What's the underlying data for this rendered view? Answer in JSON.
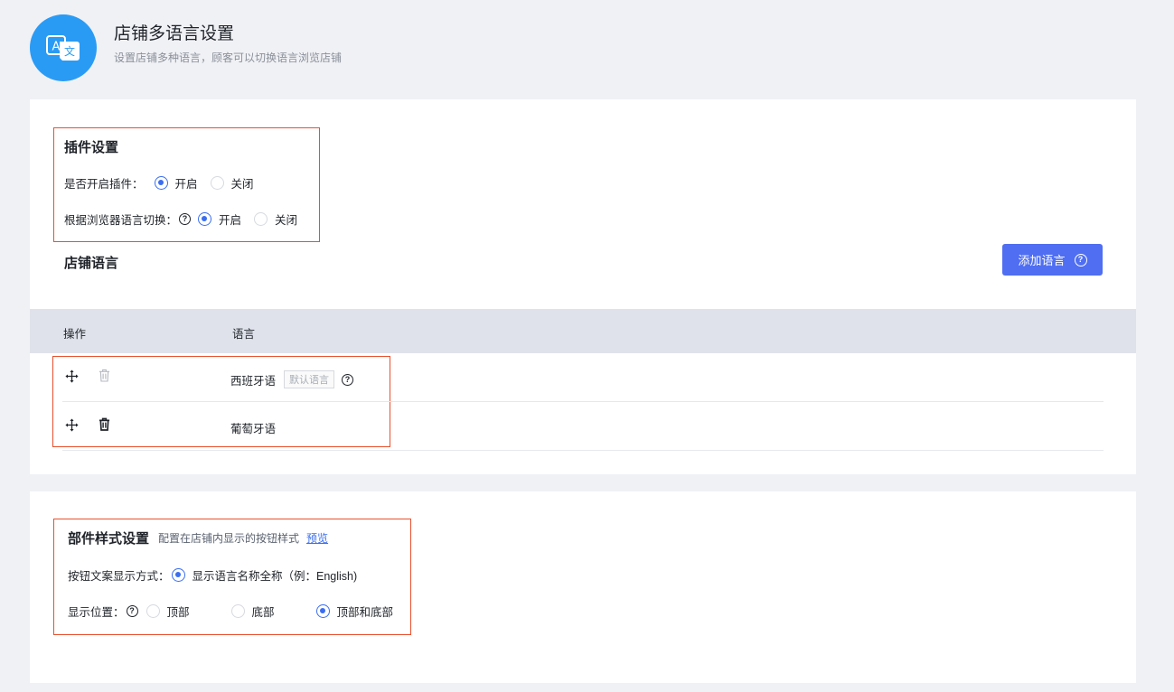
{
  "header": {
    "title": "店铺多语言设置",
    "subtitle": "设置店铺多种语言，顾客可以切换语言浏览店铺",
    "icon": "translate-icon",
    "accent_color": "#2a9bf5"
  },
  "plugin_settings": {
    "title": "插件设置",
    "enable_plugin": {
      "label": "是否开启插件：",
      "options": [
        "开启",
        "关闭"
      ],
      "selected": "开启"
    },
    "browser_switch": {
      "label": "根据浏览器语言切换：",
      "options": [
        "开启",
        "关闭"
      ],
      "selected": "开启"
    }
  },
  "store_language": {
    "title": "店铺语言",
    "add_button": "添加语言",
    "add_button_color": "#4f6ef2",
    "columns": [
      "操作",
      "语言"
    ],
    "rows": [
      {
        "language": "西班牙语",
        "tag": "默认语言",
        "delete_enabled": false
      },
      {
        "language": "葡萄牙语",
        "tag": "",
        "delete_enabled": true
      }
    ]
  },
  "widget_style": {
    "title": "部件样式设置",
    "description": "配置在店铺内显示的按钮样式",
    "preview_link": "预览",
    "button_text_mode": {
      "label": "按钮文案显示方式：",
      "options": [
        "显示语言名称全称（例：English)"
      ],
      "selected": "显示语言名称全称（例：English)"
    },
    "position": {
      "label": "显示位置：",
      "options": [
        "顶部",
        "底部",
        "顶部和底部"
      ],
      "selected": "顶部和底部"
    }
  },
  "colors": {
    "radio_checked": "#3a6ef0",
    "highlight_border": "#e8502e",
    "table_header_bg": "#dfe2ea"
  }
}
